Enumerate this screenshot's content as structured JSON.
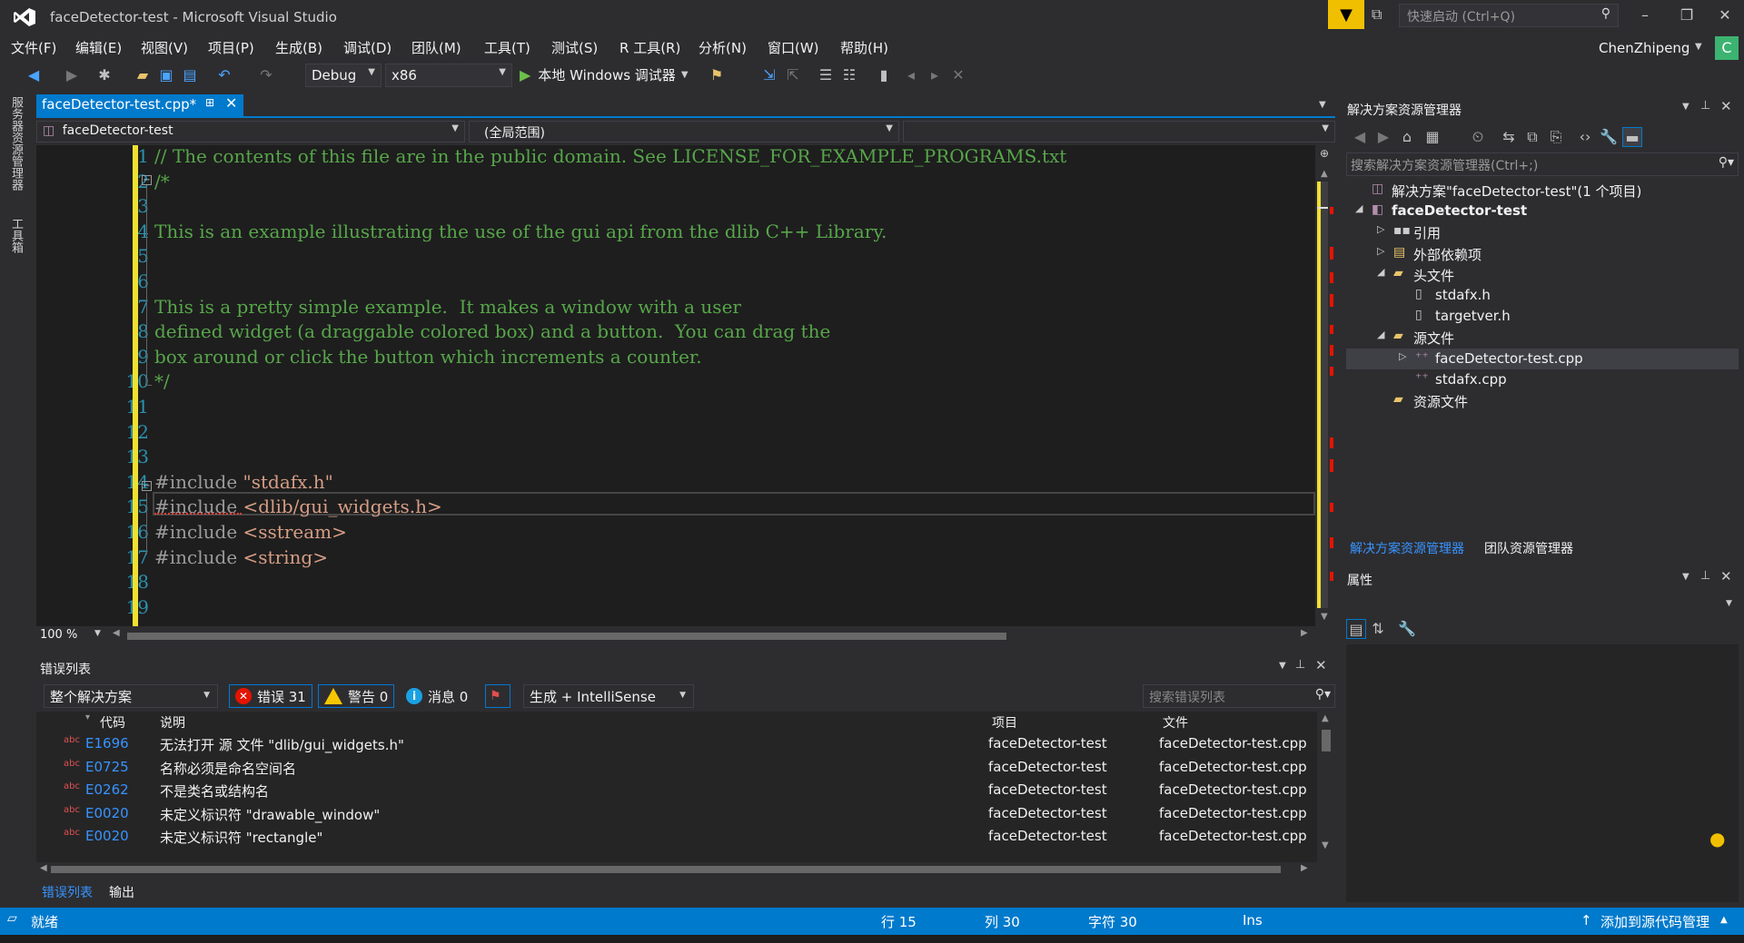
{
  "window": {
    "title": "faceDetector-test - Microsoft Visual Studio",
    "quick_launch_placeholder": "快速启动 (Ctrl+Q)",
    "user_name": "ChenZhipeng",
    "user_initial": "C"
  },
  "menu": [
    "文件(F)",
    "编辑(E)",
    "视图(V)",
    "项目(P)",
    "生成(B)",
    "调试(D)",
    "团队(M)",
    "工具(T)",
    "测试(S)",
    "R 工具(R)",
    "分析(N)",
    "窗口(W)",
    "帮助(H)"
  ],
  "toolbar": {
    "config": "Debug",
    "platform": "x86",
    "run_label": "本地 Windows 调试器"
  },
  "left_tabs": [
    "服务器资源管理器",
    "工具箱"
  ],
  "editor": {
    "tab_label": "faceDetector-test.cpp*",
    "scope_project": "faceDetector-test",
    "scope_global": "(全局范围)",
    "zoom": "100 %",
    "lines": [
      {
        "n": "1",
        "text": "// The contents of this file are in the public domain. See LICENSE_FOR_EXAMPLE_PROGRAMS.txt",
        "kind": "comment"
      },
      {
        "n": "2",
        "text": "/*",
        "kind": "comment"
      },
      {
        "n": "3",
        "text": "",
        "kind": "comment"
      },
      {
        "n": "4",
        "text": "This is an example illustrating the use of the gui api from the dlib C++ Library.",
        "kind": "comment"
      },
      {
        "n": "5",
        "text": "",
        "kind": "comment"
      },
      {
        "n": "6",
        "text": "",
        "kind": "comment"
      },
      {
        "n": "7",
        "text": "This is a pretty simple example.  It makes a window with a user",
        "kind": "comment"
      },
      {
        "n": "8",
        "text": "defined widget (a draggable colored box) and a button.  You can drag the",
        "kind": "comment"
      },
      {
        "n": "9",
        "text": "box around or click the button which increments a counter.",
        "kind": "comment"
      },
      {
        "n": "10",
        "text": "*/",
        "kind": "comment"
      },
      {
        "n": "11",
        "text": "",
        "kind": "comment"
      },
      {
        "n": "12",
        "text": "",
        "kind": "comment"
      },
      {
        "n": "13",
        "text": "",
        "kind": "comment"
      },
      {
        "n": "14",
        "directive": "#include ",
        "arg": "\"stdafx.h\"",
        "kind": "include"
      },
      {
        "n": "15",
        "directive": "#include ",
        "arg": "<dlib/gui_widgets.h>",
        "kind": "include"
      },
      {
        "n": "16",
        "directive": "#include ",
        "arg": "<sstream>",
        "kind": "include"
      },
      {
        "n": "17",
        "directive": "#include ",
        "arg": "<string>",
        "kind": "include"
      },
      {
        "n": "18",
        "text": "",
        "kind": "comment"
      },
      {
        "n": "19",
        "text": "",
        "kind": "comment"
      }
    ]
  },
  "error_list": {
    "title": "错误列表",
    "scope": "整个解决方案",
    "errors_label": "错误 31",
    "warnings_label": "警告 0",
    "messages_label": "消息 0",
    "build_filter": "生成 + IntelliSense",
    "search_placeholder": "搜索错误列表",
    "columns": [
      "代码",
      "说明",
      "项目",
      "文件"
    ],
    "rows": [
      {
        "code": "E1696",
        "desc": "无法打开 源 文件 \"dlib/gui_widgets.h\"",
        "project": "faceDetector-test",
        "file": "faceDetector-test.cpp"
      },
      {
        "code": "E0725",
        "desc": "名称必须是命名空间名",
        "project": "faceDetector-test",
        "file": "faceDetector-test.cpp"
      },
      {
        "code": "E0262",
        "desc": "不是类名或结构名",
        "project": "faceDetector-test",
        "file": "faceDetector-test.cpp"
      },
      {
        "code": "E0020",
        "desc": "未定义标识符 \"drawable_window\"",
        "project": "faceDetector-test",
        "file": "faceDetector-test.cpp"
      },
      {
        "code": "E0020",
        "desc": "未定义标识符 \"rectangle\"",
        "project": "faceDetector-test",
        "file": "faceDetector-test.cpp"
      }
    ],
    "bottom_tabs": [
      "错误列表",
      "输出"
    ]
  },
  "solution_explorer": {
    "title": "解决方案资源管理器",
    "search_placeholder": "搜索解决方案资源管理器(Ctrl+;)",
    "items": [
      {
        "label": "解决方案\"faceDetector-test\"(1 个项目)",
        "bold": false
      },
      {
        "label": "faceDetector-test",
        "bold": true
      },
      {
        "label": "引用",
        "bold": false
      },
      {
        "label": "外部依赖项",
        "bold": false
      },
      {
        "label": "头文件",
        "bold": false
      },
      {
        "label": "stdafx.h",
        "bold": false
      },
      {
        "label": "targetver.h",
        "bold": false
      },
      {
        "label": "源文件",
        "bold": false
      },
      {
        "label": "faceDetector-test.cpp",
        "bold": false
      },
      {
        "label": "stdafx.cpp",
        "bold": false
      },
      {
        "label": "资源文件",
        "bold": false
      }
    ],
    "bottom_tabs": [
      "解决方案资源管理器",
      "团队资源管理器"
    ]
  },
  "properties": {
    "title": "属性"
  },
  "status": {
    "ready": "就绪",
    "line": "行 15",
    "col": "列 30",
    "ch": "字符 30",
    "mode": "Ins",
    "source_control": "添加到源代码管理"
  },
  "colors": {
    "accent": "#007acc",
    "comment": "#57a64a",
    "string": "#d69d85",
    "directive": "#9b9b9b",
    "line_number": "#2b91af",
    "error": "#e51400"
  }
}
